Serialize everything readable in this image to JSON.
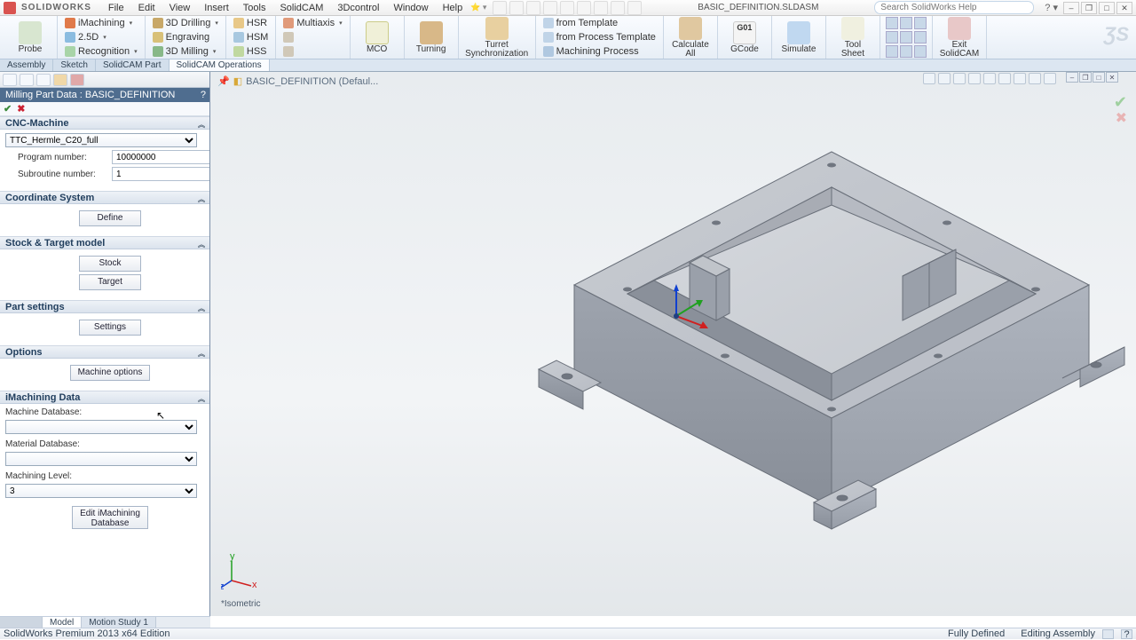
{
  "app": {
    "brand": "SOLIDWORKS",
    "doc_title": "BASIC_DEFINITION.SLDASM",
    "search_placeholder": "Search SolidWorks Help"
  },
  "menu": [
    "File",
    "Edit",
    "View",
    "Insert",
    "Tools",
    "SolidCAM",
    "3Dcontrol",
    "Window",
    "Help"
  ],
  "ribbon": {
    "probe": "Probe",
    "col1": [
      "iMachining",
      "2.5D",
      "Recognition"
    ],
    "col2": [
      "3D Drilling",
      "Engraving",
      "3D Milling"
    ],
    "col3": [
      "HSR",
      "HSM",
      "HSS"
    ],
    "multiaxis": "Multiaxis",
    "mco": "MCO",
    "turning": "Turning",
    "turret": "Turret\nSynchronization",
    "col4": [
      "from Template",
      "from Process Template",
      "Machining Process"
    ],
    "calculate": "Calculate\nAll",
    "gcode": "G01\nGCode",
    "simulate": "Simulate",
    "toolsheet": "Tool\nSheet",
    "exit": "Exit\nSolidCAM"
  },
  "doc_tabs": [
    "Assembly",
    "Sketch",
    "SolidCAM Part",
    "SolidCAM Operations"
  ],
  "doc_tabs_active": 3,
  "panel": {
    "title": "Milling Part Data : BASIC_DEFINITION",
    "cnc": {
      "header": "CNC-Machine",
      "machine": "TTC_Hermle_C20_full",
      "program_label": "Program number:",
      "program_value": "10000000",
      "sub_label": "Subroutine number:",
      "sub_value": "1"
    },
    "coord": {
      "header": "Coordinate System",
      "define": "Define"
    },
    "stock": {
      "header": "Stock & Target model",
      "stock_btn": "Stock",
      "target_btn": "Target"
    },
    "part": {
      "header": "Part settings",
      "settings_btn": "Settings"
    },
    "options": {
      "header": "Options",
      "mach_btn": "Machine options"
    },
    "imach": {
      "header": "iMachining Data",
      "mdb_label": "Machine Database:",
      "mdb_value": "",
      "mat_label": "Material Database:",
      "mat_value": "",
      "lvl_label": "Machining Level:",
      "lvl_value": "3",
      "edit_btn": "Edit iMachining\nDatabase"
    }
  },
  "viewport": {
    "tab": "BASIC_DEFINITION  (Defaul...",
    "iso": "*Isometric"
  },
  "bottom_tabs": [
    "Model",
    "Motion Study 1"
  ],
  "status": {
    "edition": "SolidWorks Premium 2013 x64 Edition",
    "defined": "Fully Defined",
    "editing": "Editing Assembly"
  }
}
